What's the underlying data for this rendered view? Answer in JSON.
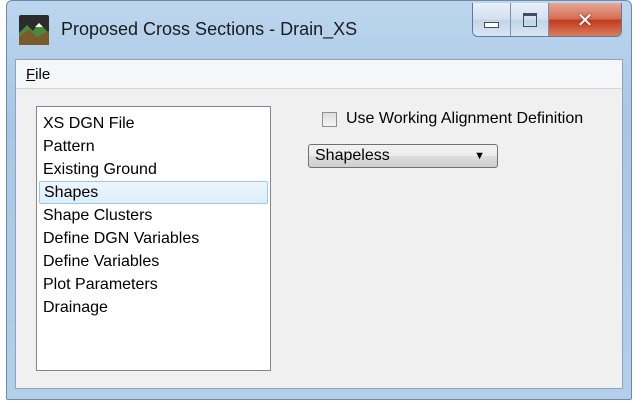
{
  "window": {
    "title": "Proposed Cross Sections - Drain_XS"
  },
  "menu": {
    "items": [
      {
        "label": "File",
        "accelerator": "F",
        "rest": "ile"
      }
    ]
  },
  "list": {
    "items": [
      {
        "label": "XS DGN File"
      },
      {
        "label": "Pattern"
      },
      {
        "label": "Existing Ground"
      },
      {
        "label": "Shapes",
        "selected": true
      },
      {
        "label": "Shape Clusters"
      },
      {
        "label": "Define DGN Variables"
      },
      {
        "label": "Define Variables"
      },
      {
        "label": "Plot Parameters"
      },
      {
        "label": "Drainage"
      }
    ]
  },
  "options": {
    "use_working_alignment": {
      "label": "Use Working Alignment Definition",
      "checked": false
    },
    "shape_mode": {
      "selected": "Shapeless"
    }
  }
}
